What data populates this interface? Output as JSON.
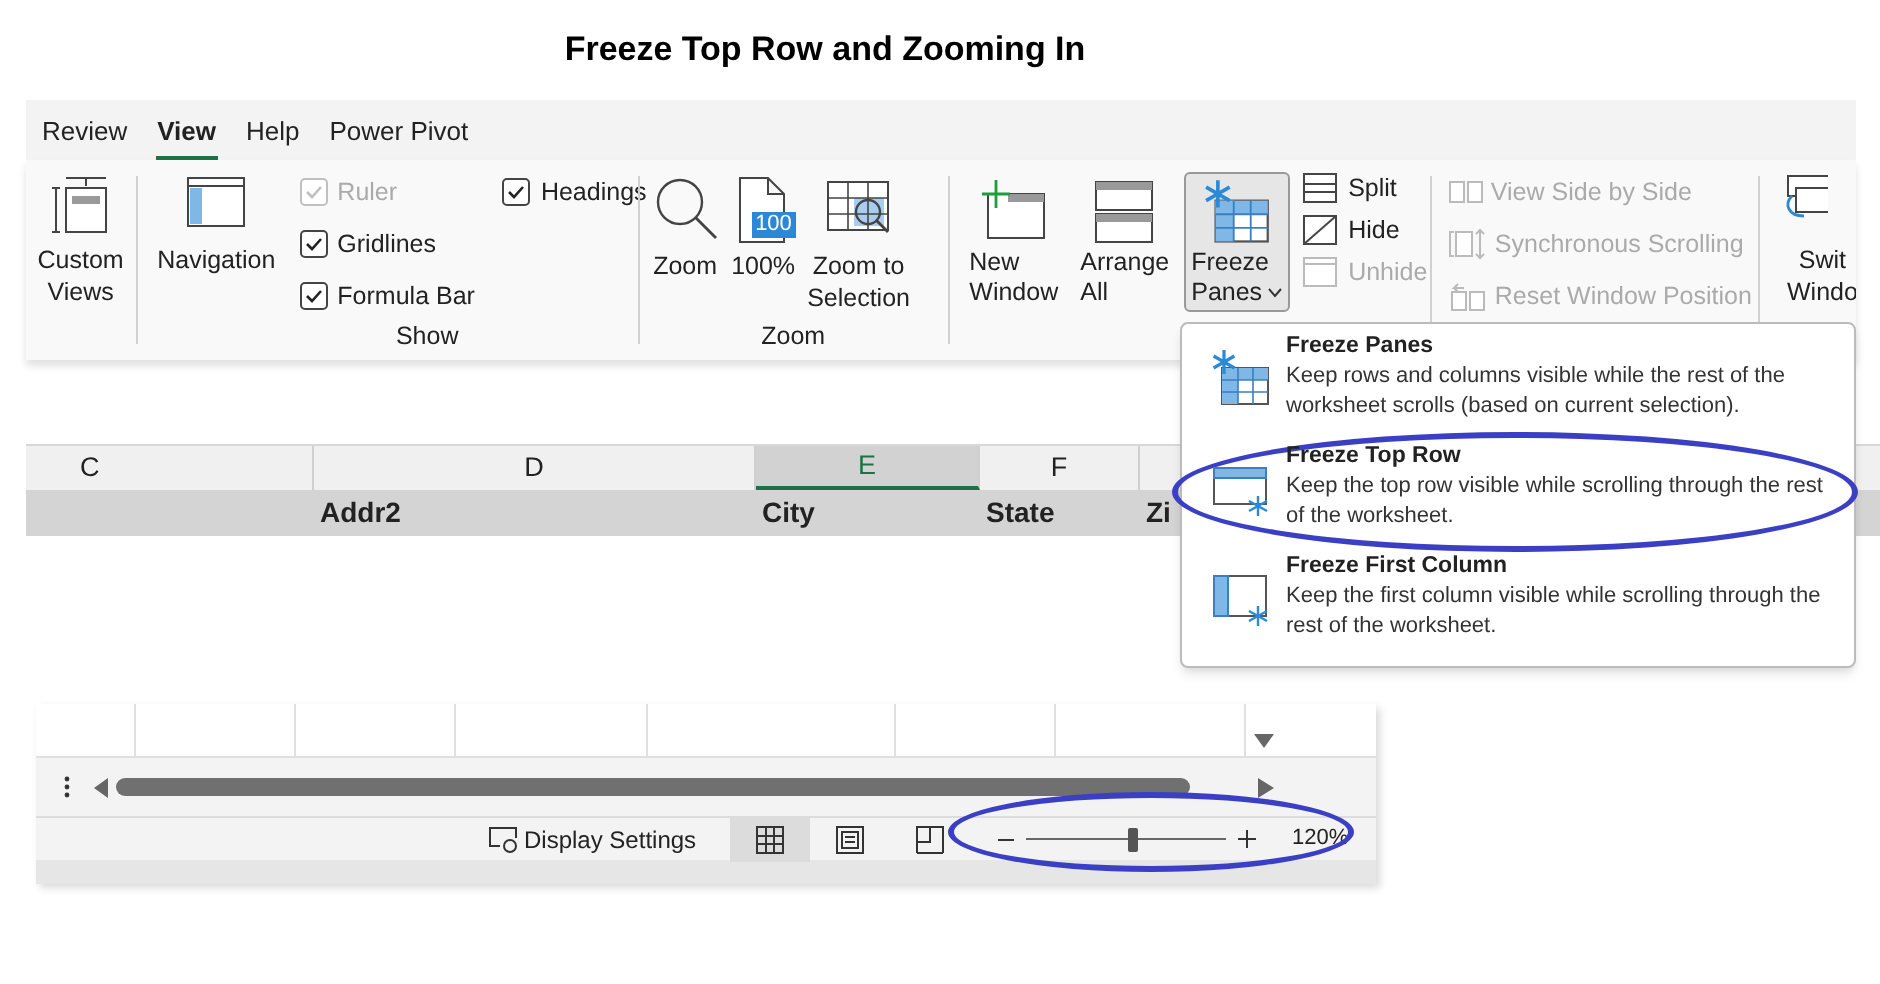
{
  "title": "Freeze Top Row and Zooming In",
  "ribbon_tabs": [
    {
      "label": "Review",
      "selected": false
    },
    {
      "label": "View",
      "selected": true
    },
    {
      "label": "Help",
      "selected": false
    },
    {
      "label": "Power Pivot",
      "selected": false
    }
  ],
  "custom_views": {
    "lines": [
      "Custom",
      "Views"
    ]
  },
  "navigation": {
    "label": "Navigation"
  },
  "show_group": {
    "label": "Show",
    "checkboxes": [
      {
        "label": "Ruler",
        "checked": true,
        "disabled": true
      },
      {
        "label": "Gridlines",
        "checked": true,
        "disabled": false
      },
      {
        "label": "Formula Bar",
        "checked": true,
        "disabled": false
      },
      {
        "label": "Headings",
        "checked": true,
        "disabled": false
      }
    ]
  },
  "zoom_group": {
    "label": "Zoom",
    "buttons": [
      {
        "kind": "zoom",
        "lines": [
          "Zoom"
        ]
      },
      {
        "kind": "hundred",
        "lines": [
          "100%"
        ],
        "icon_text": "100"
      },
      {
        "kind": "selection",
        "lines": [
          "Zoom to",
          "Selection"
        ]
      }
    ]
  },
  "window_group": {
    "large_buttons": [
      {
        "kind": "new",
        "lines": [
          "New",
          "Window"
        ],
        "selected": false
      },
      {
        "kind": "arrange",
        "lines": [
          "Arrange",
          "All"
        ],
        "selected": false
      },
      {
        "kind": "freeze",
        "lines": [
          "Freeze",
          "Panes"
        ],
        "selected": true
      }
    ],
    "small_buttons": [
      {
        "kind": "split",
        "label": "Split",
        "disabled": false
      },
      {
        "kind": "hide",
        "label": "Hide",
        "disabled": false
      },
      {
        "kind": "unhide",
        "label": "Unhide",
        "disabled": true
      }
    ],
    "side_buttons": [
      {
        "kind": "side",
        "label": "View Side by Side",
        "disabled": true
      },
      {
        "kind": "sync",
        "label": "Synchronous Scrolling",
        "disabled": true
      },
      {
        "kind": "reset",
        "label": "Reset Window Position",
        "disabled": true
      }
    ],
    "switch_windows": {
      "lines": [
        "Swit",
        "Windo"
      ]
    }
  },
  "freeze_menu": [
    {
      "kind": "panes",
      "title": "Freeze Panes",
      "description": "Keep rows and columns visible while the rest of the worksheet scrolls (based on current selection)."
    },
    {
      "kind": "top_row",
      "title": "Freeze Top Row",
      "description": "Keep the top row visible while scrolling through the rest of the worksheet."
    },
    {
      "kind": "first_column",
      "title": "Freeze First Column",
      "description": "Keep the first column visible while scrolling through the rest of the worksheet."
    }
  ],
  "sheet": {
    "columns": [
      {
        "label": "C",
        "selected": false
      },
      {
        "label": "D",
        "selected": false
      },
      {
        "label": "E",
        "selected": true
      },
      {
        "label": "F",
        "selected": false
      }
    ],
    "header_row": [
      "Addr2",
      "City",
      "State",
      "Zi"
    ]
  },
  "status_bar": {
    "display_settings": "Display Settings",
    "views": [
      {
        "kind": "normal",
        "selected": true
      },
      {
        "kind": "page_layout",
        "selected": false
      },
      {
        "kind": "page_break",
        "selected": false
      }
    ],
    "zoom_slider": {
      "level": 0.53
    },
    "zoom_reading": "120%"
  }
}
